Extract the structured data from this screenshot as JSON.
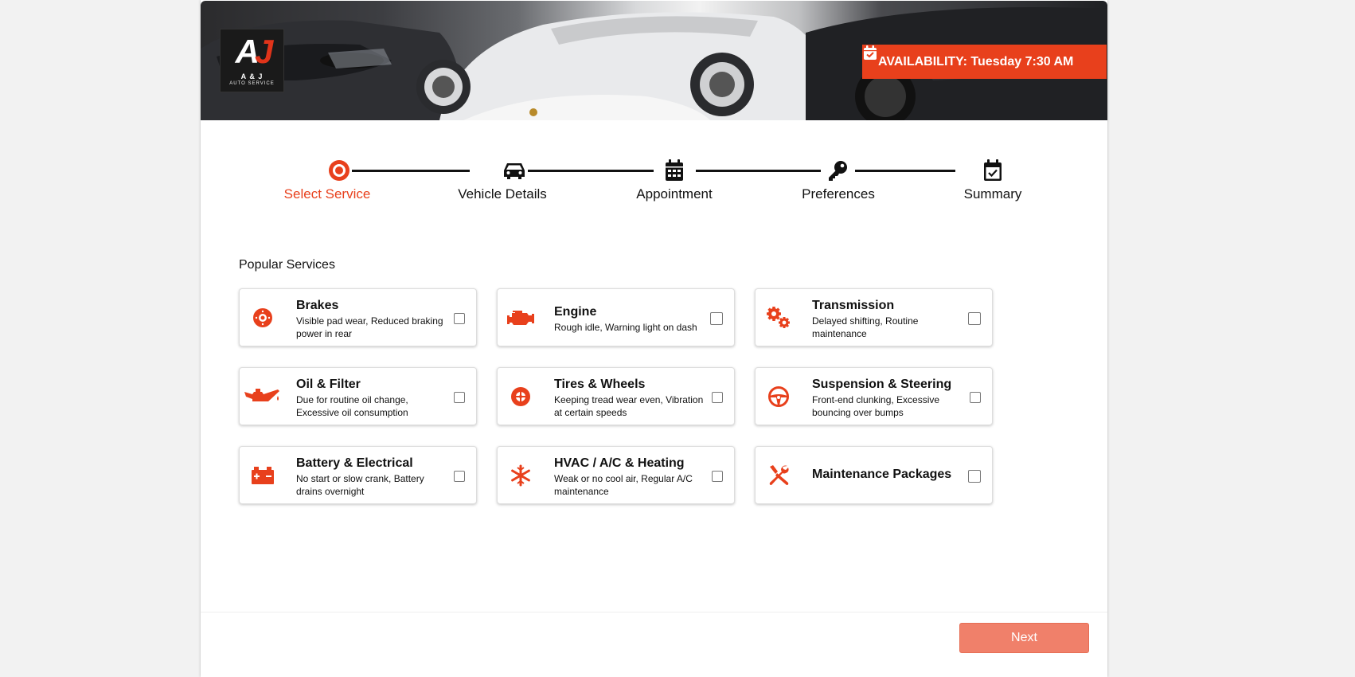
{
  "brand": {
    "logo_alt": "A&J Auto Service",
    "logo_mark": "AJ",
    "logo_name": "A & J",
    "logo_tagline": "AUTO SERVICE"
  },
  "availability": {
    "label": "AVAILABILITY: Tuesday 7:30 AM",
    "icon": "calendar-check-icon"
  },
  "colors": {
    "accent": "#e8401c",
    "next_button": "#f0806a"
  },
  "steps": [
    {
      "label": "Select Service",
      "icon": "target-icon",
      "active": true
    },
    {
      "label": "Vehicle Details",
      "icon": "car-icon",
      "active": false
    },
    {
      "label": "Appointment",
      "icon": "calendar-icon",
      "active": false
    },
    {
      "label": "Preferences",
      "icon": "key-icon",
      "active": false
    },
    {
      "label": "Summary",
      "icon": "calendar-check-icon",
      "active": false
    }
  ],
  "section_title": "Popular Services",
  "services": [
    {
      "title": "Brakes",
      "desc": "Visible pad wear, Reduced braking power in rear",
      "icon": "brake-disc-icon",
      "checked": false
    },
    {
      "title": "Engine",
      "desc": "Rough idle, Warning light on dash",
      "icon": "engine-icon",
      "checked": false
    },
    {
      "title": "Transmission",
      "desc": "Delayed shifting, Routine maintenance",
      "icon": "gears-icon",
      "checked": false
    },
    {
      "title": "Oil & Filter",
      "desc": "Due for routine oil change, Excessive oil consumption",
      "icon": "oil-can-icon",
      "checked": false
    },
    {
      "title": "Tires & Wheels",
      "desc": "Keeping tread wear even, Vibration at certain speeds",
      "icon": "tire-icon",
      "checked": false
    },
    {
      "title": "Suspension & Steering",
      "desc": "Front-end clunking, Excessive bouncing over bumps",
      "icon": "steering-wheel-icon",
      "checked": false
    },
    {
      "title": "Battery & Electrical",
      "desc": "No start or slow crank, Battery drains overnight",
      "icon": "battery-icon",
      "checked": false
    },
    {
      "title": "HVAC / A/C & Heating",
      "desc": "Weak or no cool air, Regular A/C maintenance",
      "icon": "snowflake-icon",
      "checked": false
    },
    {
      "title": "Maintenance Packages",
      "desc": "",
      "icon": "tools-icon",
      "checked": false
    }
  ],
  "next_label": "Next"
}
